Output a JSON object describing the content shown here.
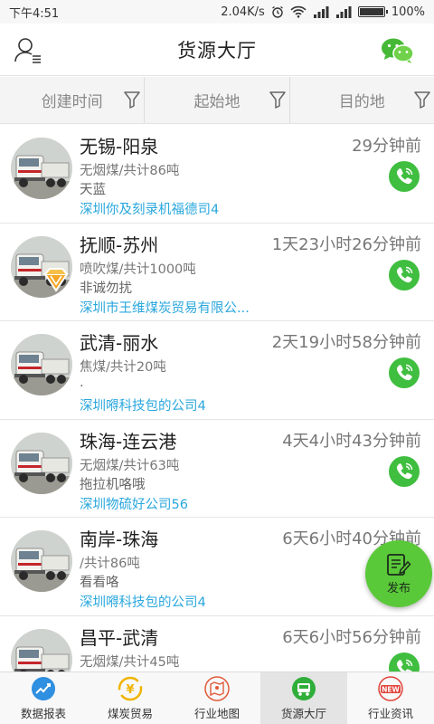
{
  "status_bar": {
    "time": "下午4:51",
    "speed": "2.04K/s",
    "battery": "100%",
    "battery_level": 1.0
  },
  "header": {
    "title": "货源大厅",
    "left_icon": "user-menu-icon",
    "right_icon": "wechat-icon"
  },
  "filters": [
    {
      "label": "创建时间"
    },
    {
      "label": "起始地"
    },
    {
      "label": "目的地"
    }
  ],
  "items": [
    {
      "route": "无锡-阳泉",
      "time": "29分钟前",
      "desc": "无烟煤/共计86吨",
      "note": "天蓝",
      "company": "深圳你及刻录机福德司4",
      "badge": false
    },
    {
      "route": "抚顺-苏州",
      "time": "1天23小时26分钟前",
      "desc": "喷吹煤/共计1000吨",
      "note": "非诚勿扰",
      "company": "深圳市王维煤炭贸易有限公...",
      "badge": true
    },
    {
      "route": "武清-丽水",
      "time": "2天19小时58分钟前",
      "desc": "焦煤/共计20吨",
      "note": ".",
      "company": "深圳嘚科技包的公司4",
      "badge": false
    },
    {
      "route": "珠海-连云港",
      "time": "4天4小时43分钟前",
      "desc": "无烟煤/共计63吨",
      "note": "拖拉机咯哦",
      "company": "深圳物硫好公司56",
      "badge": false
    },
    {
      "route": "南岸-珠海",
      "time": "6天6小时40分钟前",
      "desc": "/共计86吨",
      "note": "看看咯",
      "company": "深圳嘚科技包的公司4",
      "badge": false
    },
    {
      "route": "昌平-武清",
      "time": "6天6小时56分钟前",
      "desc": "无烟煤/共计45吨",
      "note": "",
      "company": "",
      "badge": false
    }
  ],
  "fab": {
    "label": "发布"
  },
  "nav": [
    {
      "label": "数据报表",
      "icon": "chart-icon",
      "color": "#2f8fe0"
    },
    {
      "label": "煤炭贸易",
      "icon": "yen-exchange-icon",
      "color": "#f0b400"
    },
    {
      "label": "行业地图",
      "icon": "map-icon",
      "color": "#e05a3a"
    },
    {
      "label": "货源大厅",
      "icon": "truck-icon",
      "color": "#2fae3a"
    },
    {
      "label": "行业资讯",
      "icon": "news-icon",
      "color": "#e0443a"
    }
  ],
  "colors": {
    "accent_green": "#3fbe3f",
    "link_blue": "#2aa7dd"
  }
}
